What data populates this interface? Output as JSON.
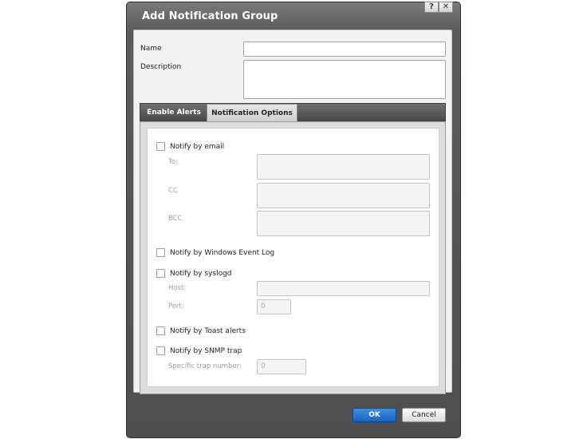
{
  "window": {
    "title": "Add Notification Group",
    "help_label": "?",
    "close_label": "✕"
  },
  "form": {
    "name_label": "Name",
    "name_value": "",
    "description_label": "Description",
    "description_value": ""
  },
  "tabs": [
    {
      "label": "Enable Alerts",
      "active": false
    },
    {
      "label": "Notification Options",
      "active": true
    }
  ],
  "options": {
    "email": {
      "label": "Notify by email",
      "checked": false,
      "to_label": "To:",
      "cc_label": "CC",
      "bcc_label": "BCC"
    },
    "event_log": {
      "label": "Notify by Windows Event Log",
      "checked": false
    },
    "syslog": {
      "label": "Notify by syslogd",
      "checked": false,
      "host_label": "Host:",
      "port_label": "Port:",
      "port_value": "0"
    },
    "toast": {
      "label": "Notify by Toast alerts",
      "checked": false
    },
    "snmp": {
      "label": "Notify by SNMP trap",
      "checked": false,
      "trap_label": "Specific trap number:",
      "trap_value": "0"
    }
  },
  "footer": {
    "ok_label": "OK",
    "cancel_label": "Cancel"
  },
  "colors": {
    "accent": "#2a74d4",
    "frame": "#5c5c5c"
  }
}
